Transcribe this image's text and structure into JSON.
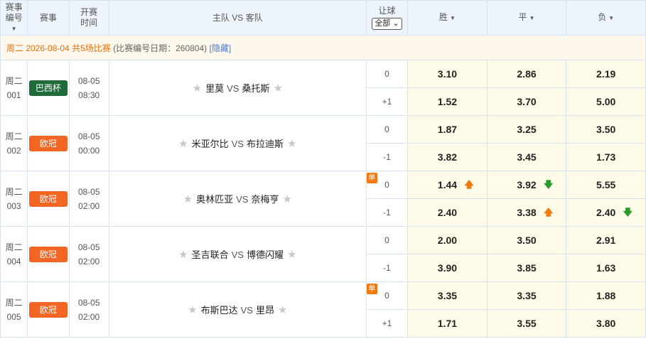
{
  "header": {
    "match_no": "赛事编号",
    "match_no_arrow": "▼",
    "league": "赛事",
    "kickoff": "开赛时间",
    "teams": "主队 VS 客队",
    "handicap": "让球",
    "handicap_select": "全部",
    "handicap_select_arrow": "⌄",
    "win": "胜",
    "draw": "平",
    "lose": "负",
    "sort_arrow": "▼"
  },
  "date_row": {
    "weekday_date": "周二 2026-08-04",
    "count": "共5场比赛",
    "date_info": "(比赛编号日期：260804)",
    "hide": "[隐藏]"
  },
  "vs_label": "VS",
  "dan_label": "单",
  "star_glyph": "★",
  "colors": {
    "up": "#f07a10",
    "down": "#2a9a2a"
  },
  "matches": [
    {
      "weekday": "周二",
      "num": "001",
      "league": "巴西杯",
      "league_color": "#1f6b3a",
      "date": "08-05",
      "time": "08:30",
      "home": "里莫",
      "away": "桑托斯",
      "dan": false,
      "lines": [
        {
          "handicap": "0",
          "win": "3.10",
          "draw": "2.86",
          "lose": "2.19",
          "win_chg": "",
          "draw_chg": "",
          "lose_chg": ""
        },
        {
          "handicap": "+1",
          "win": "1.52",
          "draw": "3.70",
          "lose": "5.00",
          "win_chg": "",
          "draw_chg": "",
          "lose_chg": ""
        }
      ]
    },
    {
      "weekday": "周二",
      "num": "002",
      "league": "欧冠",
      "league_color": "#f26522",
      "date": "08-05",
      "time": "00:00",
      "home": "米亚尔比",
      "away": "布拉迪斯",
      "dan": false,
      "lines": [
        {
          "handicap": "0",
          "win": "1.87",
          "draw": "3.25",
          "lose": "3.50",
          "win_chg": "",
          "draw_chg": "",
          "lose_chg": ""
        },
        {
          "handicap": "-1",
          "win": "3.82",
          "draw": "3.45",
          "lose": "1.73",
          "win_chg": "",
          "draw_chg": "",
          "lose_chg": ""
        }
      ]
    },
    {
      "weekday": "周二",
      "num": "003",
      "league": "欧冠",
      "league_color": "#f26522",
      "date": "08-05",
      "time": "02:00",
      "home": "奥林匹亚",
      "away": "奈梅亨",
      "dan": true,
      "lines": [
        {
          "handicap": "0",
          "win": "1.44",
          "draw": "3.92",
          "lose": "5.55",
          "win_chg": "up",
          "draw_chg": "down",
          "lose_chg": ""
        },
        {
          "handicap": "-1",
          "win": "2.40",
          "draw": "3.38",
          "lose": "2.40",
          "win_chg": "",
          "draw_chg": "up",
          "lose_chg": "down"
        }
      ]
    },
    {
      "weekday": "周二",
      "num": "004",
      "league": "欧冠",
      "league_color": "#f26522",
      "date": "08-05",
      "time": "02:00",
      "home": "圣吉联合",
      "away": "博德闪耀",
      "dan": false,
      "lines": [
        {
          "handicap": "0",
          "win": "2.00",
          "draw": "3.50",
          "lose": "2.91",
          "win_chg": "",
          "draw_chg": "",
          "lose_chg": ""
        },
        {
          "handicap": "-1",
          "win": "3.90",
          "draw": "3.85",
          "lose": "1.63",
          "win_chg": "",
          "draw_chg": "",
          "lose_chg": ""
        }
      ]
    },
    {
      "weekday": "周二",
      "num": "005",
      "league": "欧冠",
      "league_color": "#f26522",
      "date": "08-05",
      "time": "02:00",
      "home": "布斯巴达",
      "away": "里昂",
      "dan": true,
      "lines": [
        {
          "handicap": "0",
          "win": "3.35",
          "draw": "3.35",
          "lose": "1.88",
          "win_chg": "",
          "draw_chg": "",
          "lose_chg": ""
        },
        {
          "handicap": "+1",
          "win": "1.71",
          "draw": "3.55",
          "lose": "3.80",
          "win_chg": "",
          "draw_chg": "",
          "lose_chg": ""
        }
      ]
    }
  ]
}
